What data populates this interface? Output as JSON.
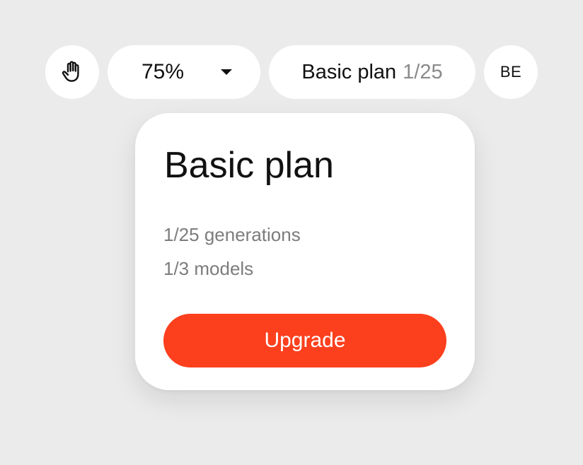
{
  "toolbar": {
    "hand_tool_icon": "hand-icon",
    "zoom": {
      "value": "75%",
      "dropdown_icon": "caret-down-icon"
    },
    "plan_chip": {
      "name": "Basic plan",
      "usage": "1/25"
    },
    "avatar_initials": "BE"
  },
  "plan_card": {
    "title": "Basic plan",
    "generations": "1/25 generations",
    "models": "1/3 models",
    "upgrade_label": "Upgrade",
    "accent_color": "#fc3f1d"
  },
  "colors": {
    "background": "#ebebeb",
    "surface": "#ffffff",
    "muted_text": "#7c7c7c"
  }
}
